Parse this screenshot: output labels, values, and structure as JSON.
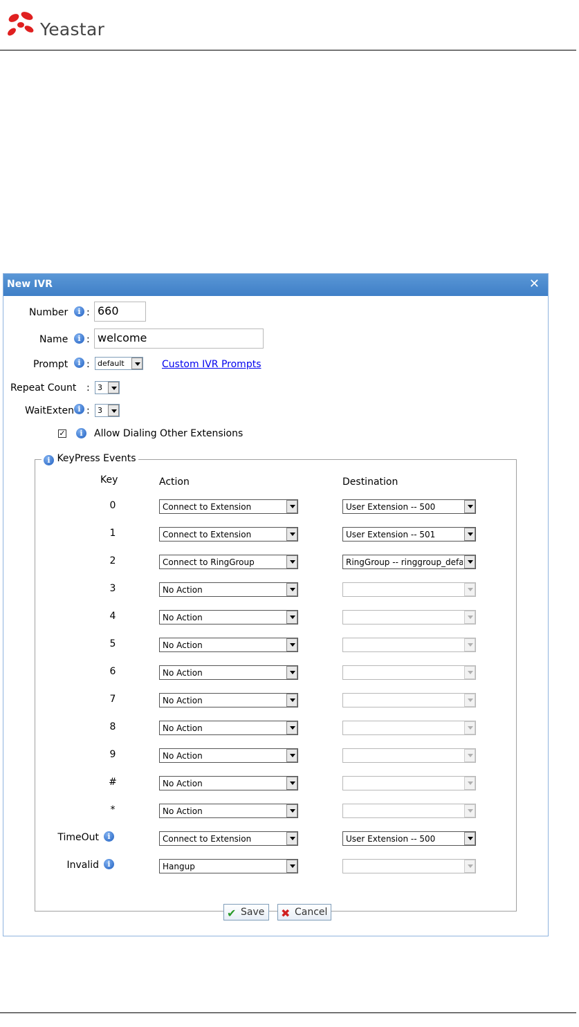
{
  "brand": {
    "name": "Yeastar"
  },
  "dialog": {
    "title": "New IVR",
    "close_symbol": "✕",
    "number_label": "Number",
    "number_value": "660",
    "name_label": "Name",
    "name_value": "welcome",
    "prompt_label": "Prompt",
    "prompt_value": "default",
    "custom_prompts_link": "Custom IVR Prompts",
    "repeat_label": "Repeat Count",
    "repeat_value": "3",
    "waitexten_label": "WaitExten",
    "waitexten_value": "3",
    "allow_dialing_label": "Allow Dialing Other Extensions",
    "allow_dialing_checked": true,
    "colon": ":",
    "check_mark": "✓"
  },
  "keypress": {
    "legend": "KeyPress Events",
    "col_key": "Key",
    "col_action": "Action",
    "col_destination": "Destination",
    "rows": [
      {
        "key": "0",
        "action": "Connect to Extension",
        "destination": "User Extension -- 500",
        "dest_enabled": true
      },
      {
        "key": "1",
        "action": "Connect to Extension",
        "destination": "User Extension -- 501",
        "dest_enabled": true
      },
      {
        "key": "2",
        "action": "Connect to RingGroup",
        "destination": "RingGroup -- ringgroup_defa",
        "dest_enabled": true
      },
      {
        "key": "3",
        "action": "No Action",
        "destination": "",
        "dest_enabled": false
      },
      {
        "key": "4",
        "action": "No Action",
        "destination": "",
        "dest_enabled": false
      },
      {
        "key": "5",
        "action": "No Action",
        "destination": "",
        "dest_enabled": false
      },
      {
        "key": "6",
        "action": "No Action",
        "destination": "",
        "dest_enabled": false
      },
      {
        "key": "7",
        "action": "No Action",
        "destination": "",
        "dest_enabled": false
      },
      {
        "key": "8",
        "action": "No Action",
        "destination": "",
        "dest_enabled": false
      },
      {
        "key": "9",
        "action": "No Action",
        "destination": "",
        "dest_enabled": false
      },
      {
        "key": "#",
        "action": "No Action",
        "destination": "",
        "dest_enabled": false
      },
      {
        "key": "*",
        "action": "No Action",
        "destination": "",
        "dest_enabled": false
      },
      {
        "key": "TimeOut",
        "action": "Connect to Extension",
        "destination": "User Extension -- 500",
        "dest_enabled": true,
        "info": true
      },
      {
        "key": "Invalid",
        "action": "Hangup",
        "destination": "",
        "dest_enabled": false,
        "info": true
      }
    ]
  },
  "buttons": {
    "save": "Save",
    "cancel": "Cancel",
    "save_icon": "✔",
    "cancel_icon": "✖"
  },
  "icons": {
    "info": "i"
  },
  "colors": {
    "titlebar": "#4a8bd0",
    "info_icon": "#1f5fc0",
    "link": "#0000ee"
  }
}
